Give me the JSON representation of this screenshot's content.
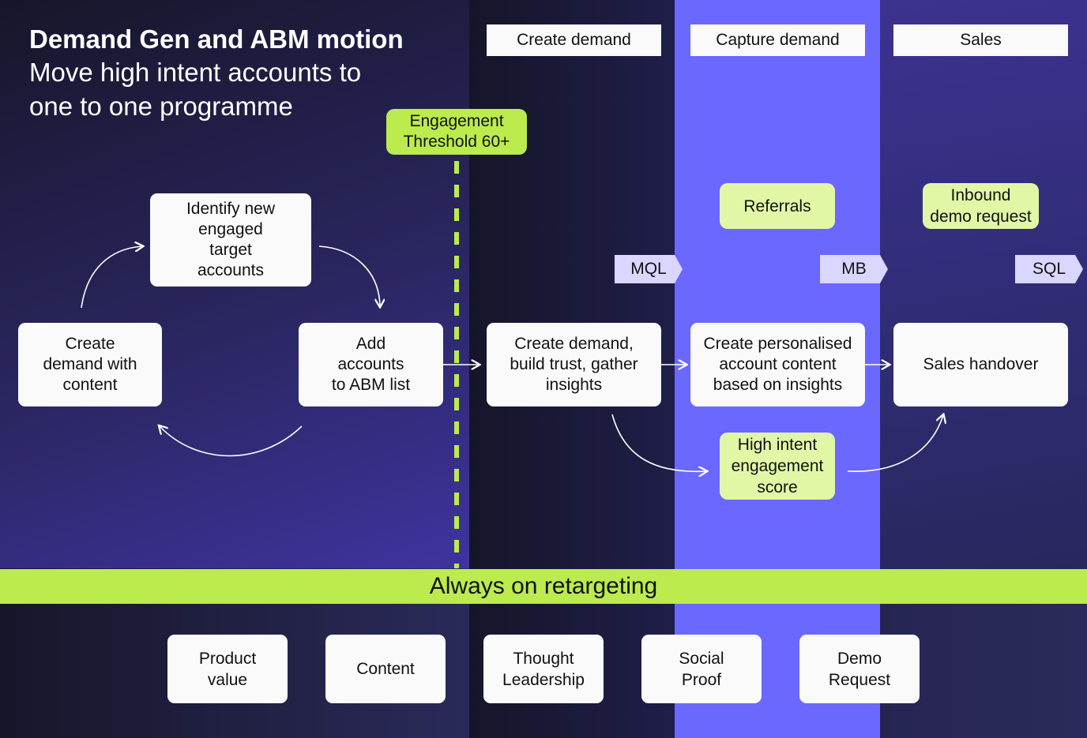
{
  "title": {
    "main": "Demand Gen and ABM motion",
    "subtitle": "Move high intent accounts to\none to one programme"
  },
  "stages": [
    {
      "label": "Create demand"
    },
    {
      "label": "Capture demand"
    },
    {
      "label": "Sales"
    }
  ],
  "threshold": {
    "label": "Engagement\nThreshold 60+"
  },
  "cycle": {
    "identify": "Identify new\nengaged\ntarget\naccounts",
    "create_content": "Create\ndemand with\ncontent",
    "add_accounts": "Add\naccounts\nto ABM list"
  },
  "flow": {
    "create_demand": "Create demand,\nbuild trust, gather\ninsights",
    "personalised": "Create personalised\naccount content\nbased on insights",
    "handover": "Sales handover"
  },
  "signals": {
    "referrals": "Referrals",
    "inbound": "Inbound\ndemo request",
    "high_intent": "High intent\nengagement\nscore"
  },
  "tags": {
    "mql": "MQL",
    "mb": "MB",
    "sql": "SQL"
  },
  "band": {
    "label": "Always on retargeting"
  },
  "channels": [
    {
      "label": "Product\nvalue"
    },
    {
      "label": "Content"
    },
    {
      "label": "Thought\nLeadership"
    },
    {
      "label": "Social\nProof"
    },
    {
      "label": "Demo\nRequest"
    }
  ],
  "colors": {
    "accent_green": "#bbeb4d",
    "soft_green": "#e1f7a6",
    "capture_lane": "#6b68ff",
    "tag_bg": "#d9d7ff",
    "dark_bg": "#16162a"
  }
}
